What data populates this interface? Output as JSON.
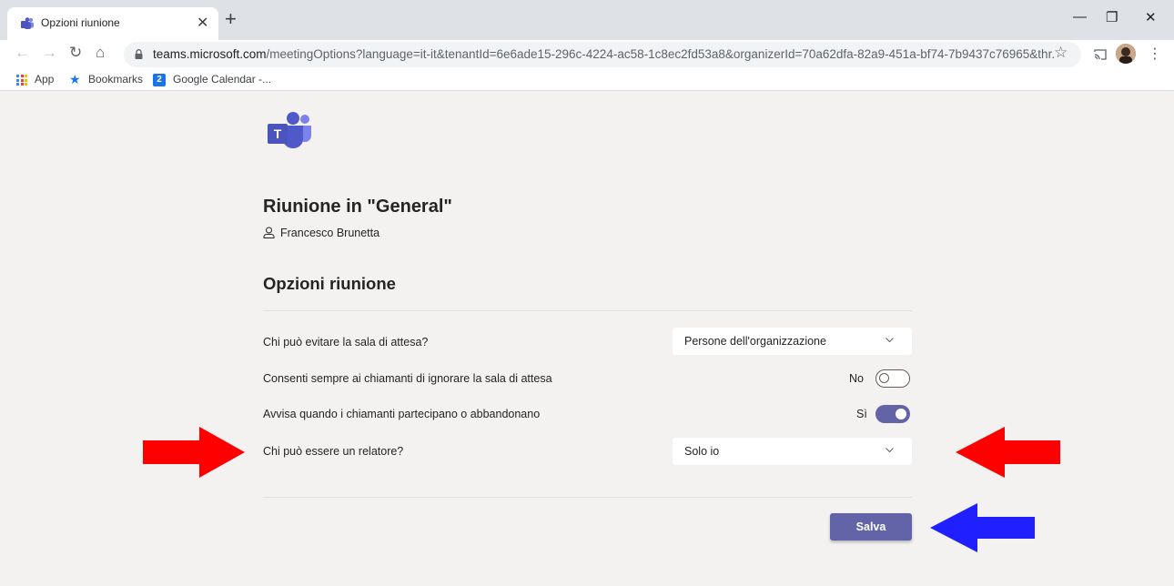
{
  "browser": {
    "tab_title": "Opzioni riunione",
    "url_domain": "teams.microsoft.com",
    "url_rest": "/meetingOptions?language=it-it&tenantId=6e6ade15-296c-4224-ac58-1c8ec2fd53a8&organizerId=70a62dfa-82a9-451a-bf74-7b9437c76965&thr...",
    "bookmarks": [
      {
        "label": "App"
      },
      {
        "label": "Bookmarks"
      },
      {
        "label": "Google Calendar -..."
      }
    ],
    "calendar_icon_text": "2"
  },
  "meeting": {
    "title": "Riunione in \"General\"",
    "organizer": "Francesco Brunetta",
    "logo_letter": "T"
  },
  "options": {
    "section_title": "Opzioni riunione",
    "lobby_bypass": {
      "label": "Chi può evitare la sala di attesa?",
      "value": "Persone dell'organizzazione"
    },
    "dialin_bypass": {
      "label": "Consenti sempre ai chiamanti di ignorare la sala di attesa",
      "state_text": "No",
      "enabled": false
    },
    "notify_join_leave": {
      "label": "Avvisa quando i chiamanti partecipano o abbandonano",
      "state_text": "Sì",
      "enabled": true
    },
    "presenter": {
      "label": "Chi può essere un relatore?",
      "value": "Solo io"
    },
    "save_label": "Salva"
  },
  "colors": {
    "accent": "#6264a7",
    "annotation_red": "#ff0000",
    "annotation_blue": "#1f1fff"
  }
}
